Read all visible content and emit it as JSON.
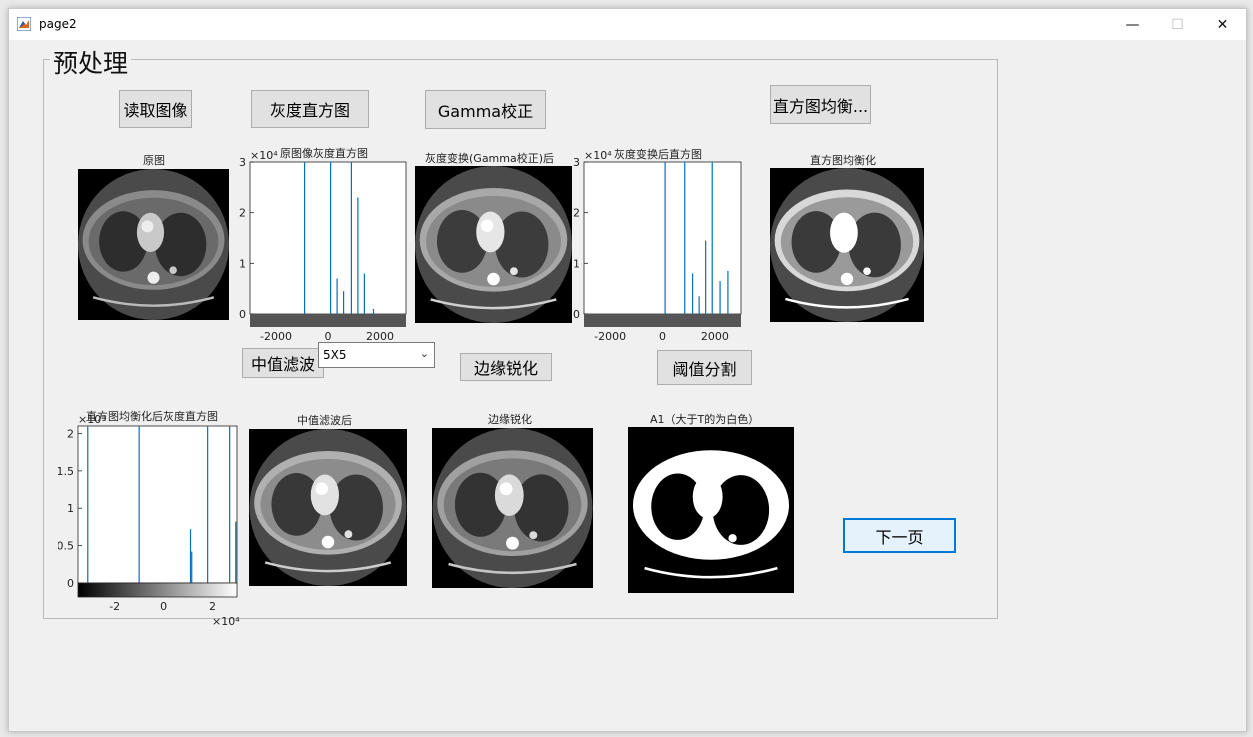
{
  "window": {
    "title": "page2",
    "minimize": "—",
    "maximize": "☐",
    "close": "✕"
  },
  "panel": {
    "title": "预处理"
  },
  "buttons": {
    "read_image": "读取图像",
    "gray_histogram": "灰度直方图",
    "gamma": "Gamma校正",
    "hist_equalize": "直方图均衡...",
    "median_filter": "中值滤波",
    "edge_sharpen": "边缘锐化",
    "threshold": "阈值分割",
    "next_page": "下一页"
  },
  "filter_select": {
    "value": "5X5"
  },
  "axes": {
    "original": "原图",
    "orig_hist": "原图像灰度直方图",
    "gamma_img": "灰度变换(Gamma校正)后",
    "gamma_hist": "灰度变换后直方图",
    "equalized": "直方图均衡化",
    "eq_hist": "直方图均衡化后灰度直方图",
    "median": "中值滤波后",
    "edge": "边缘锐化",
    "threshold": "A1（大于T的为白色）"
  },
  "icons": {
    "app": "matlab-icon"
  },
  "chart_data": [
    {
      "type": "bar",
      "title": "原图像灰度直方图",
      "exponent": "×10⁴",
      "ylim": [
        0,
        3
      ],
      "yticks": [
        "0",
        "1",
        "2",
        "3"
      ],
      "xlim": [
        -3000,
        3000
      ],
      "xticks": [
        "-2000",
        "0",
        "2000"
      ],
      "x": [
        -900,
        100,
        900,
        1150,
        1400,
        1750,
        350,
        600
      ],
      "values": [
        3.2,
        3.2,
        3.2,
        2.3,
        0.8,
        0.1,
        0.7,
        0.45
      ]
    },
    {
      "type": "bar",
      "title": "灰度变换后直方图",
      "exponent": "×10⁴",
      "ylim": [
        0,
        3
      ],
      "yticks": [
        "0",
        "1",
        "2",
        "3"
      ],
      "xlim": [
        -3000,
        3000
      ],
      "xticks": [
        "-2000",
        "0",
        "2000"
      ],
      "x": [
        100,
        850,
        1900,
        1150,
        1400,
        1650,
        2200,
        2500
      ],
      "values": [
        3.2,
        3.2,
        3.2,
        0.8,
        0.35,
        1.45,
        0.65,
        0.85
      ],
      "colorbar": true
    },
    {
      "type": "bar",
      "title": "直方图均衡化后灰度直方图",
      "exponent": "×10⁴",
      "ylim": [
        0,
        2.1
      ],
      "yticks": [
        "0",
        "0.5",
        "1",
        "1.5",
        "2"
      ],
      "xlim": [
        -3.5,
        3
      ],
      "xticks": [
        "-2",
        "0",
        "2"
      ],
      "xexponent": "×10⁴",
      "x": [
        -3.1,
        -1.0,
        1.1,
        1.15,
        1.8,
        2.7,
        2.95
      ],
      "values": [
        2.2,
        2.2,
        0.72,
        0.42,
        2.2,
        2.2,
        0.82
      ],
      "colorbar": true
    }
  ]
}
